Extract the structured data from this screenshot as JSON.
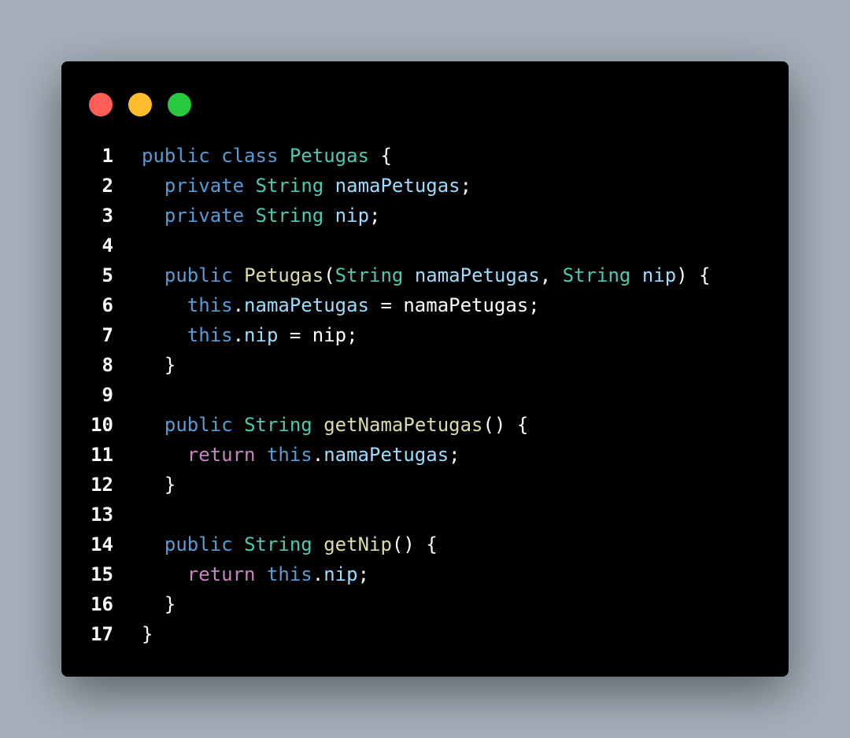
{
  "window": {
    "controls": [
      {
        "name": "close",
        "color": "#ff5f56"
      },
      {
        "name": "minimize",
        "color": "#ffbd2e"
      },
      {
        "name": "maximize",
        "color": "#27c93f"
      }
    ]
  },
  "code": {
    "language": "java",
    "lines": [
      {
        "number": "1",
        "tokens": [
          [
            "public",
            "keyword"
          ],
          [
            " ",
            "plain"
          ],
          [
            "class",
            "keyword"
          ],
          [
            " ",
            "plain"
          ],
          [
            "Petugas",
            "type"
          ],
          [
            " {",
            "plain"
          ]
        ]
      },
      {
        "number": "2",
        "tokens": [
          [
            "  ",
            "plain"
          ],
          [
            "private",
            "keyword"
          ],
          [
            " ",
            "plain"
          ],
          [
            "String",
            "type"
          ],
          [
            " ",
            "plain"
          ],
          [
            "namaPetugas",
            "var"
          ],
          [
            ";",
            "plain"
          ]
        ]
      },
      {
        "number": "3",
        "tokens": [
          [
            "  ",
            "plain"
          ],
          [
            "private",
            "keyword"
          ],
          [
            " ",
            "plain"
          ],
          [
            "String",
            "type"
          ],
          [
            " ",
            "plain"
          ],
          [
            "nip",
            "var"
          ],
          [
            ";",
            "plain"
          ]
        ]
      },
      {
        "number": "4",
        "tokens": []
      },
      {
        "number": "5",
        "tokens": [
          [
            "  ",
            "plain"
          ],
          [
            "public",
            "keyword"
          ],
          [
            " ",
            "plain"
          ],
          [
            "Petugas",
            "func"
          ],
          [
            "(",
            "plain"
          ],
          [
            "String",
            "type"
          ],
          [
            " ",
            "plain"
          ],
          [
            "namaPetugas",
            "var"
          ],
          [
            ", ",
            "plain"
          ],
          [
            "String",
            "type"
          ],
          [
            " ",
            "plain"
          ],
          [
            "nip",
            "var"
          ],
          [
            ") {",
            "plain"
          ]
        ]
      },
      {
        "number": "6",
        "tokens": [
          [
            "    ",
            "plain"
          ],
          [
            "this",
            "keyword"
          ],
          [
            ".",
            "plain"
          ],
          [
            "namaPetugas",
            "var"
          ],
          [
            " = namaPetugas;",
            "plain"
          ]
        ]
      },
      {
        "number": "7",
        "tokens": [
          [
            "    ",
            "plain"
          ],
          [
            "this",
            "keyword"
          ],
          [
            ".",
            "plain"
          ],
          [
            "nip",
            "var"
          ],
          [
            " = nip;",
            "plain"
          ]
        ]
      },
      {
        "number": "8",
        "tokens": [
          [
            "  }",
            "plain"
          ]
        ]
      },
      {
        "number": "9",
        "tokens": []
      },
      {
        "number": "10",
        "tokens": [
          [
            "  ",
            "plain"
          ],
          [
            "public",
            "keyword"
          ],
          [
            " ",
            "plain"
          ],
          [
            "String",
            "type"
          ],
          [
            " ",
            "plain"
          ],
          [
            "getNamaPetugas",
            "func"
          ],
          [
            "() {",
            "plain"
          ]
        ]
      },
      {
        "number": "11",
        "tokens": [
          [
            "    ",
            "plain"
          ],
          [
            "return",
            "control"
          ],
          [
            " ",
            "plain"
          ],
          [
            "this",
            "keyword"
          ],
          [
            ".",
            "plain"
          ],
          [
            "namaPetugas",
            "var"
          ],
          [
            ";",
            "plain"
          ]
        ]
      },
      {
        "number": "12",
        "tokens": [
          [
            "  }",
            "plain"
          ]
        ]
      },
      {
        "number": "13",
        "tokens": []
      },
      {
        "number": "14",
        "tokens": [
          [
            "  ",
            "plain"
          ],
          [
            "public",
            "keyword"
          ],
          [
            " ",
            "plain"
          ],
          [
            "String",
            "type"
          ],
          [
            " ",
            "plain"
          ],
          [
            "getNip",
            "func"
          ],
          [
            "() {",
            "plain"
          ]
        ]
      },
      {
        "number": "15",
        "tokens": [
          [
            "    ",
            "plain"
          ],
          [
            "return",
            "control"
          ],
          [
            " ",
            "plain"
          ],
          [
            "this",
            "keyword"
          ],
          [
            ".",
            "plain"
          ],
          [
            "nip",
            "var"
          ],
          [
            ";",
            "plain"
          ]
        ]
      },
      {
        "number": "16",
        "tokens": [
          [
            "  }",
            "plain"
          ]
        ]
      },
      {
        "number": "17",
        "tokens": [
          [
            "}",
            "plain"
          ]
        ]
      }
    ]
  }
}
